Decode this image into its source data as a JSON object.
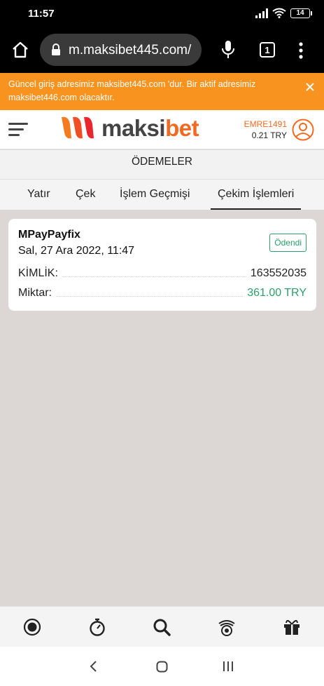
{
  "status_bar": {
    "time": "11:57",
    "battery": "14"
  },
  "browser": {
    "url": "m.maksibet445.com/",
    "tab_count": "1"
  },
  "banner": {
    "text": "Güncel giriş adresimiz maksibet445.com 'dur. Bir aktif adresimiz maksibet446.com olacaktır."
  },
  "header": {
    "logo_text_a": "maksi",
    "logo_text_b": "bet",
    "username": "EMRE1491",
    "balance": "0.21 TRY"
  },
  "page_title": "ÖDEMELER",
  "tabs": [
    {
      "label": "Yatır"
    },
    {
      "label": "Çek"
    },
    {
      "label": "İşlem Geçmişi"
    },
    {
      "label": "Çekim İşlemleri"
    }
  ],
  "transaction": {
    "method": "MPayPayfix",
    "date": "Sal, 27 Ara 2022, 11:47",
    "status": "Ödendi",
    "id_label": "KİMLİK:",
    "id_value": "163552035",
    "amount_label": "Miktar:",
    "amount_value": "361.00 TRY"
  },
  "colors": {
    "brand": "#f26a21",
    "banner": "#f7931e",
    "success": "#2e9e6a"
  },
  "bottom_nav_icons": [
    "live-icon",
    "stopwatch-icon",
    "search-icon",
    "casino-chip-icon",
    "gift-icon"
  ]
}
